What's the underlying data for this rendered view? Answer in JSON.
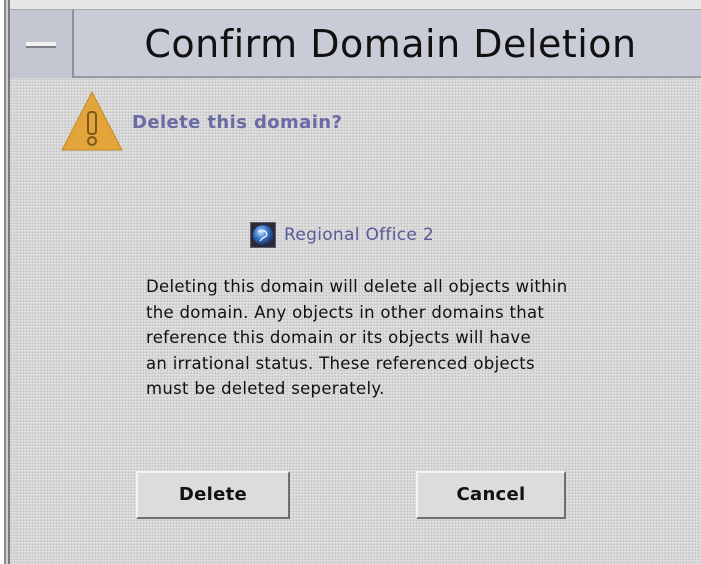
{
  "window": {
    "title": "Confirm Domain Deletion"
  },
  "dialog": {
    "question": "Delete this domain?",
    "domain_name": "Regional Office 2",
    "message_lines": [
      "Deleting this domain will delete all objects within",
      "the domain.  Any objects in other domains that",
      "reference this domain or its objects will have",
      "an irrational status.  These referenced objects",
      "must be deleted seperately."
    ],
    "buttons": {
      "delete_label": "Delete",
      "cancel_label": "Cancel"
    }
  },
  "icons": {
    "warning": "warning-icon",
    "globe": "globe-icon",
    "window_menu": "window-menu-icon"
  },
  "colors": {
    "accent_text": "#6a6aa6",
    "warning": "#e3a43a",
    "titlebar": "#c9ccd6",
    "panel": "#d7d7d7"
  }
}
